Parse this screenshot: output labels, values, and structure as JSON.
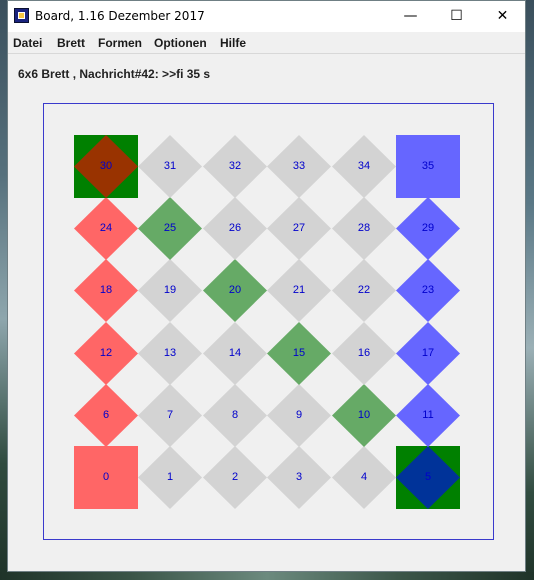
{
  "window": {
    "title": "Board, 1.16 Dezember 2017",
    "controls": {
      "minimize": "—",
      "maximize": "☐",
      "close": "✕"
    }
  },
  "menu": {
    "items": [
      {
        "label": "Datei"
      },
      {
        "label": "Brett"
      },
      {
        "label": "Formen"
      },
      {
        "label": "Optionen"
      },
      {
        "label": "Hilfe"
      }
    ]
  },
  "status": {
    "text": "6x6 Brett , Nachricht#42: >>fi 35 s"
  },
  "colors": {
    "gray": "#d3d3d3",
    "red": "#ff6666",
    "blue": "#6666ff",
    "lightgreen": "#66aa66",
    "darkgreen": "#008000",
    "brown": "#993300",
    "navy": "#003399",
    "label": "#0000cc",
    "frame": "#3a3acc"
  },
  "board": {
    "size": "6x6",
    "cells": [
      {
        "label": "0",
        "square": "red",
        "diamond": ""
      },
      {
        "label": "1",
        "square": "",
        "diamond": "gray"
      },
      {
        "label": "2",
        "square": "",
        "diamond": "gray"
      },
      {
        "label": "3",
        "square": "",
        "diamond": "gray"
      },
      {
        "label": "4",
        "square": "",
        "diamond": "gray"
      },
      {
        "label": "5",
        "square": "darkgreen",
        "diamond": "navy"
      },
      {
        "label": "6",
        "square": "",
        "diamond": "red"
      },
      {
        "label": "7",
        "square": "",
        "diamond": "gray"
      },
      {
        "label": "8",
        "square": "",
        "diamond": "gray"
      },
      {
        "label": "9",
        "square": "",
        "diamond": "gray"
      },
      {
        "label": "10",
        "square": "",
        "diamond": "lightgreen"
      },
      {
        "label": "11",
        "square": "",
        "diamond": "blue"
      },
      {
        "label": "12",
        "square": "",
        "diamond": "red"
      },
      {
        "label": "13",
        "square": "",
        "diamond": "gray"
      },
      {
        "label": "14",
        "square": "",
        "diamond": "gray"
      },
      {
        "label": "15",
        "square": "",
        "diamond": "lightgreen"
      },
      {
        "label": "16",
        "square": "",
        "diamond": "gray"
      },
      {
        "label": "17",
        "square": "",
        "diamond": "blue"
      },
      {
        "label": "18",
        "square": "",
        "diamond": "red"
      },
      {
        "label": "19",
        "square": "",
        "diamond": "gray"
      },
      {
        "label": "20",
        "square": "",
        "diamond": "lightgreen"
      },
      {
        "label": "21",
        "square": "",
        "diamond": "gray"
      },
      {
        "label": "22",
        "square": "",
        "diamond": "gray"
      },
      {
        "label": "23",
        "square": "",
        "diamond": "blue"
      },
      {
        "label": "24",
        "square": "",
        "diamond": "red"
      },
      {
        "label": "25",
        "square": "",
        "diamond": "lightgreen"
      },
      {
        "label": "26",
        "square": "",
        "diamond": "gray"
      },
      {
        "label": "27",
        "square": "",
        "diamond": "gray"
      },
      {
        "label": "28",
        "square": "",
        "diamond": "gray"
      },
      {
        "label": "29",
        "square": "",
        "diamond": "blue"
      },
      {
        "label": "30",
        "square": "darkgreen",
        "diamond": "brown"
      },
      {
        "label": "31",
        "square": "",
        "diamond": "gray"
      },
      {
        "label": "32",
        "square": "",
        "diamond": "gray"
      },
      {
        "label": "33",
        "square": "",
        "diamond": "gray"
      },
      {
        "label": "34",
        "square": "",
        "diamond": "gray"
      },
      {
        "label": "35",
        "square": "blue",
        "diamond": ""
      }
    ]
  }
}
